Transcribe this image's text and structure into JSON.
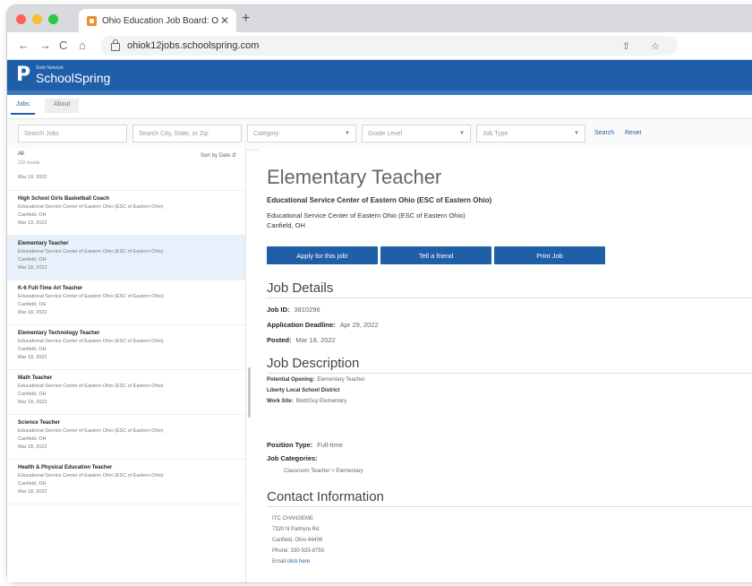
{
  "browser": {
    "tab_title": "Ohio Education Job Board: On",
    "tab_close": "✕",
    "new_tab": "+",
    "url": "ohiok12jobs.schoolspring.com",
    "back": "←",
    "forward": "→",
    "reload": "C",
    "home": "⌂",
    "omni_icons": "⇧ ☆"
  },
  "brand": {
    "sub": "Sixth Network",
    "name": "SchoolSpring",
    "logo_letter": "P"
  },
  "page_tabs": [
    "Jobs",
    "About"
  ],
  "filters": {
    "search_jobs": "Search Jobs",
    "search_location": "Search City, State, or Zip",
    "category": "Category",
    "grade_level": "Grade Level",
    "job_type": "Job Type",
    "search_label": "Search",
    "reset_label": "Reset"
  },
  "list": {
    "all_label": "All",
    "count": "222 results",
    "sort_label": "Sort by Date",
    "first_date": "Mar 19, 2022",
    "items": [
      {
        "title": "High School Girls Basketball Coach",
        "org": "Educational Service Center of Eastern Ohio (ESC of Eastern Ohio)",
        "location": "Canfield, OH",
        "date": "Mar 19, 2022"
      },
      {
        "title": "Elementary Teacher",
        "org": "Educational Service Center of Eastern Ohio (ESC of Eastern Ohio)",
        "location": "Canfield, OH",
        "date": "Mar 18, 2022"
      },
      {
        "title": "K-6 Full-Time Art Teacher",
        "org": "Educational Service Center of Eastern Ohio (ESC of Eastern Ohio)",
        "location": "Canfield, OH",
        "date": "Mar 18, 2022"
      },
      {
        "title": "Elementary Technology Teacher",
        "org": "Educational Service Center of Eastern Ohio (ESC of Eastern Ohio)",
        "location": "Canfield, OH",
        "date": "Mar 18, 2022"
      },
      {
        "title": "Math Teacher",
        "org": "Educational Service Center of Eastern Ohio (ESC of Eastern Ohio)",
        "location": "Canfield, OH",
        "date": "Mar 18, 2022"
      },
      {
        "title": "Science Teacher",
        "org": "Educational Service Center of Eastern Ohio (ESC of Eastern Ohio)",
        "location": "Canfield, OH",
        "date": "Mar 18, 2022"
      },
      {
        "title": "Health & Physical Education Teacher",
        "org": "Educational Service Center of Eastern Ohio (ESC of Eastern Ohio)",
        "location": "Canfield, OH",
        "date": "Mar 18, 2022"
      }
    ]
  },
  "detail": {
    "title": "Elementary Teacher",
    "org_bold": "Educational Service Center of Eastern Ohio (ESC of Eastern Ohio)",
    "org_line": "Educational Service Center of Eastern Ohio (ESC of Eastern Ohio)",
    "city": "Canfield, OH",
    "buttons": [
      "Apply for this job!",
      "Tell a friend",
      "Print Job"
    ],
    "job_details_heading": "Job Details",
    "job_id_label": "Job ID:",
    "job_id": "3810296",
    "deadline_label": "Application Deadline:",
    "deadline": "Apr 29, 2022",
    "posted_label": "Posted:",
    "posted": "Mar 18, 2022",
    "description_heading": "Job Description",
    "potential_opening_label": "Potential Opening:",
    "potential_opening": "Elementary Teacher",
    "district": "Liberty Local School District",
    "work_site_label": "Work Site:",
    "work_site": "Blott/Guy Elementary",
    "position_type_label": "Position Type:",
    "position_type": "Full-time",
    "categories_label": "Job Categories:",
    "categories": "Classroom Teacher > Elementary",
    "contact_heading": "Contact Information",
    "contact": {
      "name": "ITC CHANGEME",
      "address1": "7320 N Palmyra Rd",
      "address2": "Canfield, Ohio 44406",
      "phone": "Phone: 330-533-8755",
      "email_label": "Email:",
      "email_link": "click here"
    }
  }
}
